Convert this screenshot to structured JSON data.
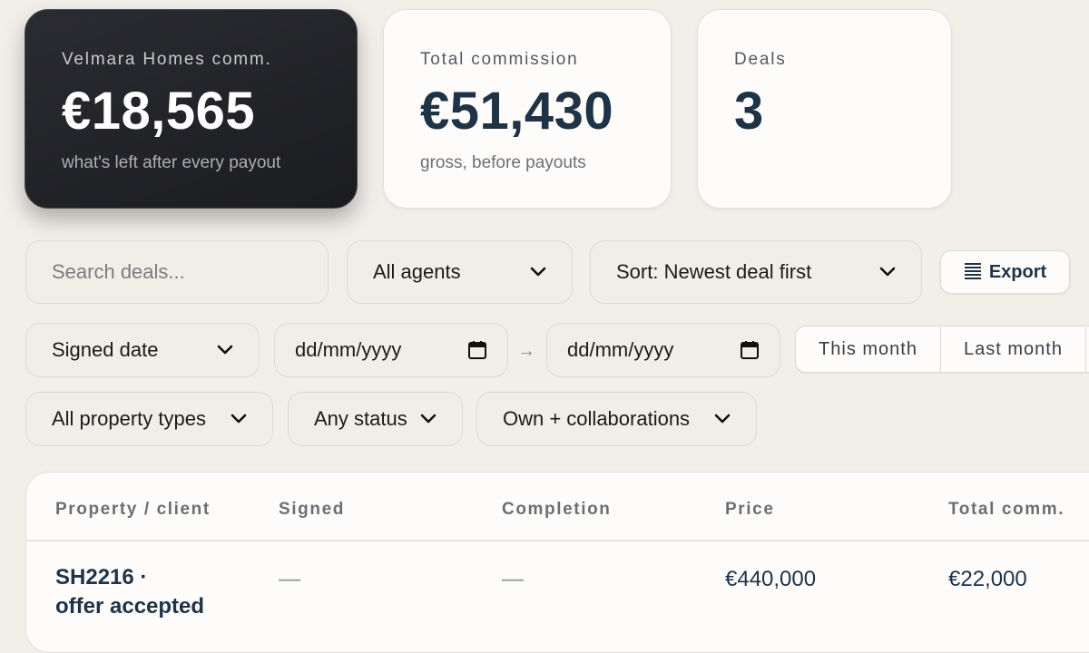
{
  "cards": [
    {
      "label": "Velmara Homes comm.",
      "value": "€18,565",
      "sub": "what's left after every payout"
    },
    {
      "label": "Total commission",
      "value": "€51,430",
      "sub": "gross, before payouts"
    },
    {
      "label": "Deals",
      "value": "3",
      "sub": ""
    }
  ],
  "filters": {
    "search_placeholder": "Search deals...",
    "agents": "All agents",
    "sort": "Sort: Newest deal first",
    "export_label": "Export",
    "date_field": "Signed date",
    "date_from": "dd/mm/yyyy",
    "date_sep": "→",
    "date_to": "dd/mm/yyyy",
    "quick_ranges": [
      "This month",
      "Last month"
    ],
    "property_types": "All property types",
    "status": "Any status",
    "ownership": "Own + collaborations"
  },
  "table": {
    "columns": [
      "Property / client",
      "Signed",
      "Completion",
      "Price",
      "Total comm."
    ],
    "rows": [
      {
        "property_line1": "SH2216 ·",
        "property_line2": "offer accepted",
        "signed": "—",
        "completion": "—",
        "price": "€440,000",
        "total_comm": "€22,000"
      }
    ]
  },
  "colors": {
    "accent": "#1f3347",
    "background": "#f2efe9",
    "dark_card": "#1e1f23"
  },
  "icons": [
    "chevron-down-icon",
    "calendar-icon",
    "list-icon",
    "arrow-right-icon"
  ]
}
